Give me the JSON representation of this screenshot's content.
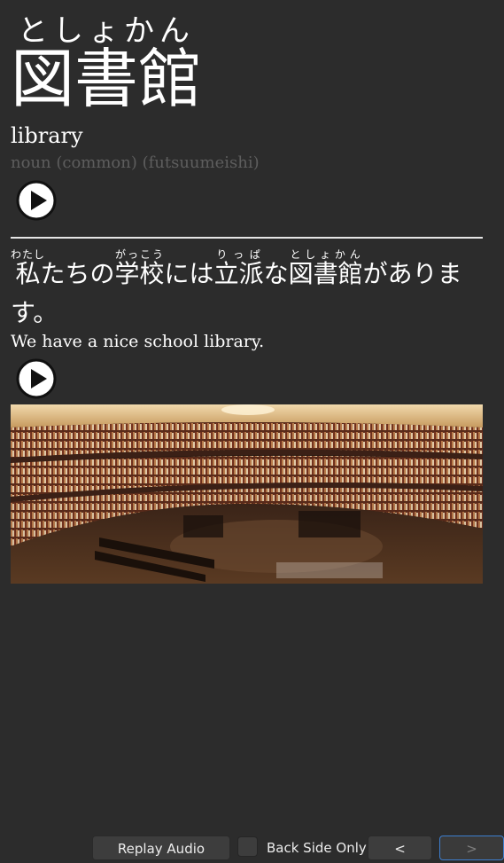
{
  "front": {
    "reading": "としょかん",
    "kanji": "図書館",
    "meaning": "library",
    "part_of_speech": "noun (common) (futsuumeishi)"
  },
  "sentence": {
    "segments": [
      {
        "text": "私",
        "ruby": "わたし"
      },
      {
        "text": "たちの"
      },
      {
        "text": "学校",
        "ruby": "がっこう"
      },
      {
        "text": "には"
      },
      {
        "text": "立派",
        "ruby": "りっぱ"
      },
      {
        "text": "な"
      },
      {
        "text": "図書館",
        "ruby": "としょかん"
      },
      {
        "text": "があります。"
      }
    ],
    "translation": "We have a nice school library."
  },
  "icons": {
    "word_audio": "play-circle-icon",
    "sentence_audio": "play-circle-icon"
  },
  "image": {
    "subject": "circular library interior with bookshelves"
  },
  "toolbar": {
    "replay_label": "Replay Audio",
    "back_side_label": "Back Side Only",
    "back_side_checked": false,
    "prev_label": "<",
    "next_label": ">"
  },
  "colors": {
    "background": "#2c2c2c",
    "text": "#ffffff",
    "muted": "#5e5e5e",
    "focus_border": "#3d7ecf"
  }
}
